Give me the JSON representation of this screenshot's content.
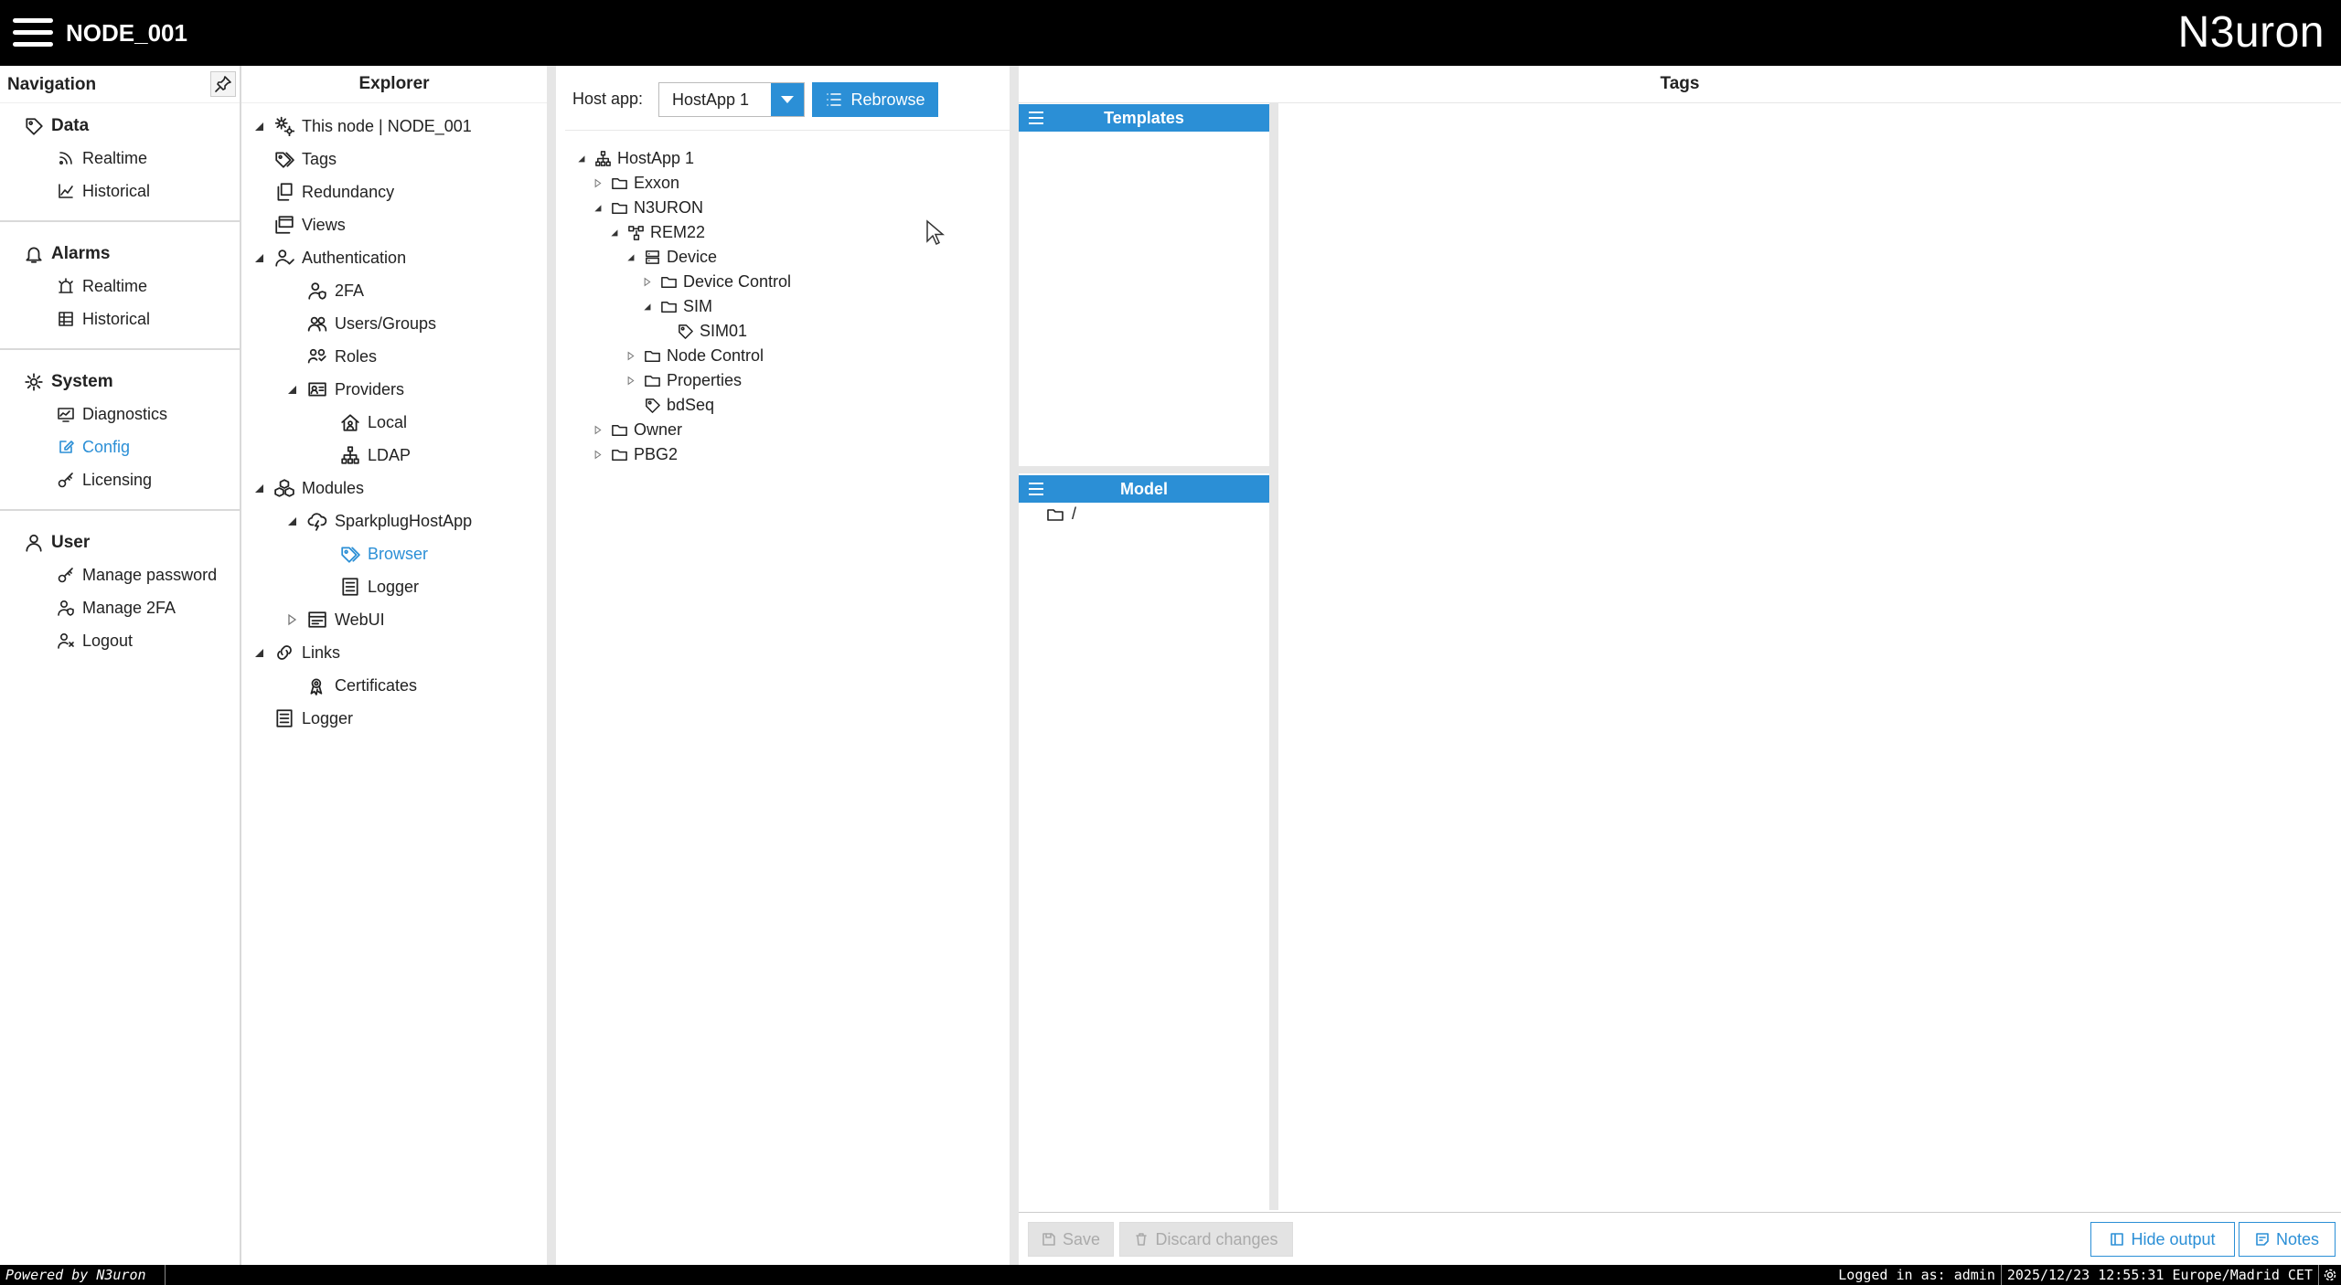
{
  "header": {
    "title": "NODE_001",
    "logo": "N3uron"
  },
  "navigation": {
    "title": "Navigation",
    "pin_icon": "pin-icon",
    "sections": [
      {
        "label": "Data",
        "icon": "tag-icon",
        "items": [
          {
            "label": "Realtime",
            "icon": "rss-icon"
          },
          {
            "label": "Historical",
            "icon": "line-chart-icon"
          }
        ]
      },
      {
        "label": "Alarms",
        "icon": "bell-icon",
        "items": [
          {
            "label": "Realtime",
            "icon": "alarm-light-icon"
          },
          {
            "label": "Historical",
            "icon": "table-icon"
          }
        ]
      },
      {
        "label": "System",
        "icon": "gear-icon",
        "items": [
          {
            "label": "Diagnostics",
            "icon": "monitor-icon"
          },
          {
            "label": "Config",
            "icon": "edit-icon",
            "active": true
          },
          {
            "label": "Licensing",
            "icon": "key-icon"
          }
        ]
      },
      {
        "label": "User",
        "icon": "user-icon",
        "items": [
          {
            "label": "Manage password",
            "icon": "key-icon"
          },
          {
            "label": "Manage 2FA",
            "icon": "user-shield-icon"
          },
          {
            "label": "Logout",
            "icon": "user-x-icon"
          }
        ]
      }
    ]
  },
  "explorer": {
    "title": "Explorer",
    "items": [
      {
        "label": "This node | NODE_001",
        "icon": "gears-icon",
        "expand": "expanded"
      },
      {
        "label": "Tags",
        "icon": "tags-icon"
      },
      {
        "label": "Redundancy",
        "icon": "copy-icon"
      },
      {
        "label": "Views",
        "icon": "window-icon"
      },
      {
        "label": "Authentication",
        "icon": "user-check-icon",
        "expand": "expanded"
      },
      {
        "label": "2FA",
        "icon": "user-shield-icon"
      },
      {
        "label": "Users/Groups",
        "icon": "users-icon"
      },
      {
        "label": "Roles",
        "icon": "user-roles-icon"
      },
      {
        "label": "Providers",
        "icon": "id-card-icon",
        "expand": "expanded"
      },
      {
        "label": "Local",
        "icon": "home-user-icon"
      },
      {
        "label": "LDAP",
        "icon": "sitemap-icon"
      },
      {
        "label": "Modules",
        "icon": "cubes-icon",
        "expand": "expanded"
      },
      {
        "label": "SparkplugHostApp",
        "icon": "cloud-bolt-icon",
        "expand": "expanded"
      },
      {
        "label": "Browser",
        "icon": "tags-icon",
        "active": true
      },
      {
        "label": "Logger",
        "icon": "list-icon"
      },
      {
        "label": "WebUI",
        "icon": "browser-window-icon",
        "expand": "collapsed"
      },
      {
        "label": "Links",
        "icon": "link-icon",
        "expand": "expanded"
      },
      {
        "label": "Certificates",
        "icon": "certificate-icon"
      },
      {
        "label": "Logger",
        "icon": "list-icon"
      }
    ]
  },
  "browser": {
    "host_label": "Host app:",
    "host_value": "HostApp 1",
    "rebrowse_label": "Rebrowse",
    "tree": [
      {
        "label": "HostApp 1",
        "icon": "sitemap-icon",
        "expand": "expanded"
      },
      {
        "label": "Exxon",
        "icon": "folder-icon",
        "expand": "collapsed"
      },
      {
        "label": "N3URON",
        "icon": "folder-icon",
        "expand": "expanded"
      },
      {
        "label": "REM22",
        "icon": "node-icon",
        "expand": "expanded"
      },
      {
        "label": "Device",
        "icon": "server-icon",
        "expand": "expanded"
      },
      {
        "label": "Device Control",
        "icon": "folder-icon",
        "expand": "collapsed"
      },
      {
        "label": "SIM",
        "icon": "folder-icon",
        "expand": "expanded"
      },
      {
        "label": "SIM01",
        "icon": "tag-icon"
      },
      {
        "label": "Node Control",
        "icon": "folder-icon",
        "expand": "collapsed"
      },
      {
        "label": "Properties",
        "icon": "folder-icon",
        "expand": "collapsed"
      },
      {
        "label": "bdSeq",
        "icon": "tag-icon"
      },
      {
        "label": "Owner",
        "icon": "folder-icon",
        "expand": "collapsed"
      },
      {
        "label": "PBG2",
        "icon": "folder-icon",
        "expand": "collapsed"
      }
    ]
  },
  "tags": {
    "title": "Tags",
    "templates_title": "Templates",
    "model_title": "Model",
    "model_root": "/",
    "footer": {
      "save": "Save",
      "discard": "Discard changes",
      "hide_output": "Hide output",
      "notes": "Notes"
    }
  },
  "statusbar": {
    "powered": "Powered by N3uron",
    "logged": "Logged in as: admin",
    "datetime": "2025/12/23 12:55:31 Europe/Madrid CET"
  },
  "colors": {
    "accent": "#2b8fd6",
    "header_bg": "#000000"
  }
}
